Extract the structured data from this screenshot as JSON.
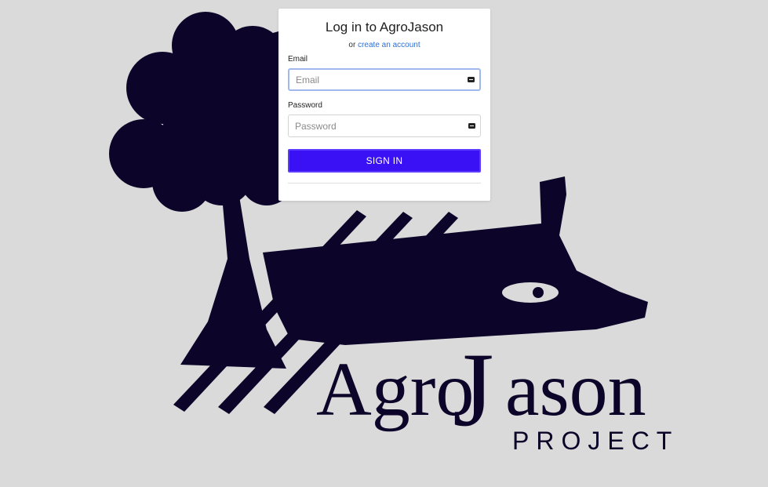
{
  "login": {
    "title": "Log in to AgroJason",
    "sub_prefix": "or",
    "create_account_link": "create an account",
    "email_label": "Email",
    "email_placeholder": "Email",
    "email_value": "",
    "password_label": "Password",
    "password_placeholder": "Password",
    "password_value": "",
    "signin_label": "SIGN IN"
  },
  "brand": {
    "word_agro": "Agro",
    "word_j": "J",
    "word_ason": "ason",
    "word_project": "PROJECT"
  },
  "colors": {
    "background": "#dadada",
    "logo": "#0d0529",
    "primary_button": "#3a10f5",
    "link": "#2d6fd6"
  },
  "icons": {
    "email_field_icon": "password-key-icon",
    "password_field_icon": "password-key-icon"
  }
}
